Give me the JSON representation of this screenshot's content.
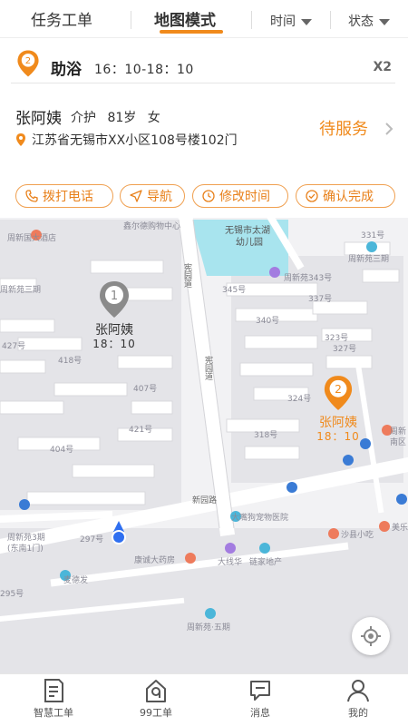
{
  "topbar": {
    "tab_orders": "任务工单",
    "tab_map": "地图模式",
    "filter_time": "时间",
    "filter_status": "状态"
  },
  "order": {
    "badge_number": "2",
    "service_name": "助浴",
    "service_time": "16：10-18：10",
    "count": "X2",
    "client_name": "张阿姨",
    "client_role": "介护",
    "client_age": "81岁",
    "client_gender": "女",
    "address": "江苏省无锡市XX小区108号楼102门",
    "status": "待服务"
  },
  "actions": {
    "call": "拨打电话",
    "navigate": "导航",
    "change_time": "修改时间",
    "confirm": "确认完成"
  },
  "map": {
    "labels": {
      "xinzhou_hotel": "周新国大酒店",
      "xinzhou_san": "周新苑三期",
      "xinzhou_san_b": "周新苑三期",
      "xinzhou_3": "周新苑3期",
      "xinzhou_3_gate": "(东南1门)",
      "xinzhou_5": "周新苑·五期",
      "kindergarten_1": "无锡市太湖",
      "kindergarten_2": "幼儿园",
      "mall": "鑫尔德购物中心",
      "xinzhou_343": "周新苑343号",
      "xinzhou_south_1": "周新",
      "xinzhou_south_2": "南区",
      "road_xianyuan": "宪园道",
      "road_xianyuan_2": "宪园道",
      "road_xinguo": "新园路",
      "pet_hospital": "大嘴狗宠物医院",
      "snack": "沙县小吃",
      "meile": "美乐乐",
      "kangcheng": "康诚大药房",
      "dachihua": "大线华",
      "realestate": "链家地产",
      "mcdonalds": "麦德发",
      "b345": "345号",
      "b340": "340号",
      "b327": "327号",
      "b318": "318号",
      "b407": "407号",
      "b418": "418号",
      "b427": "427号",
      "b404": "404号",
      "b421": "421号",
      "b461": "461号",
      "b323": "323号",
      "b337": "337号",
      "b324": "324号",
      "b331": "331号",
      "b297": "297号",
      "b295": "295号"
    }
  },
  "markers": [
    {
      "number": "1",
      "name": "张阿姨",
      "time": "18：10"
    },
    {
      "number": "2",
      "name": "张阿姨",
      "time": "18：10"
    }
  ],
  "nav": {
    "smart_orders": "智慧工单",
    "orders_99": "99工单",
    "messages": "消息",
    "mine": "我的"
  },
  "colors": {
    "accent": "#f08a1c",
    "pin_gray": "#8a8a8a",
    "water": "#a8e4ee",
    "location_blue": "#2f6ff0"
  }
}
